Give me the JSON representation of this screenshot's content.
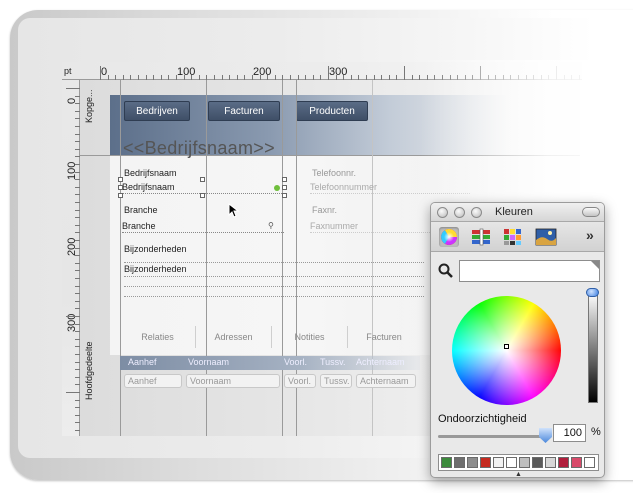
{
  "ruler": {
    "unit": "pt",
    "top_labels": [
      "0",
      "100",
      "200",
      "300"
    ],
    "left_labels": [
      "0",
      "100",
      "200",
      "300"
    ]
  },
  "parts": {
    "header": "Kopge...",
    "body": "Hoofdgedeelte"
  },
  "layout": {
    "tabs": [
      "Bedrijven",
      "Facturen",
      "Producten"
    ],
    "title": "<<Bedrijfsnaam>>",
    "left_fields": [
      {
        "label": "Bedrijfsnaam",
        "value": "Bedrijfsnaam"
      },
      {
        "label": "Branche",
        "value": "Branche"
      },
      {
        "label": "Bijzonderheden",
        "value": "Bijzonderheden"
      }
    ],
    "right_fields": [
      {
        "label": "Telefoonnr.",
        "value": "Telefoonnummer"
      },
      {
        "label": "Faxnr.",
        "value": "Faxnummer"
      }
    ],
    "bottom_tabs": [
      "Relaties",
      "Adressen",
      "Notities",
      "Facturen"
    ],
    "portal_headers": [
      "Aanhef",
      "Voornaam",
      "Voorl.",
      "Tussv.",
      "Achternaam"
    ],
    "portal_fields": [
      "Aanhef",
      "Voornaam",
      "Voorl.",
      "Tussv.",
      "Achternaam"
    ]
  },
  "color_panel": {
    "title": "Kleuren",
    "tools": [
      "color-wheel",
      "color-sliders",
      "color-palettes",
      "image-palettes"
    ],
    "more": "»",
    "opacity_label": "Ondoorzichtigheid",
    "opacity_value": "100",
    "opacity_unit": "%",
    "opacity_level": 1.0,
    "favorites": [
      "#3c8a3c",
      "#6e6e6e",
      "#8c8c8c",
      "#c52b20",
      "#f2f2f2",
      "#ffffff",
      "#bfbfbf",
      "#5a5a5a",
      "#d7d7d7",
      "#b01e3c",
      "#d84a6a",
      "#ffffff"
    ],
    "accent": "#3b7de0"
  }
}
